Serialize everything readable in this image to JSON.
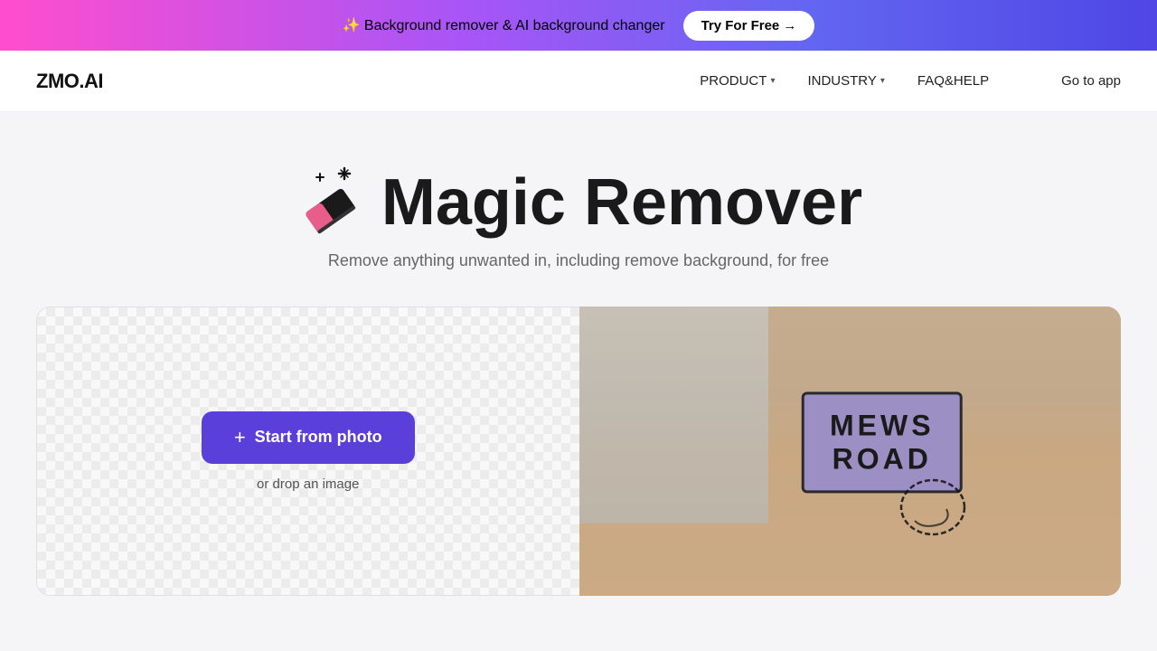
{
  "banner": {
    "icon": "✨",
    "text": "Background remover & AI background changer",
    "button_label": "Try For Free →"
  },
  "navbar": {
    "logo": "ZMO.AI",
    "links": [
      {
        "label": "PRODUCT",
        "has_dropdown": true
      },
      {
        "label": "INDUSTRY",
        "has_dropdown": true
      },
      {
        "label": "FAQ&HELP",
        "has_dropdown": false
      }
    ],
    "go_to_app": "Go to app"
  },
  "hero": {
    "title": "Magic Remover",
    "subtitle": "Remove anything unwanted in, including remove background, for free"
  },
  "upload": {
    "start_button": "Start from photo",
    "drop_text": "or drop an image",
    "plus_icon": "+"
  },
  "preview": {
    "sign_line1": "MEWS",
    "sign_line2": "ROAD"
  }
}
